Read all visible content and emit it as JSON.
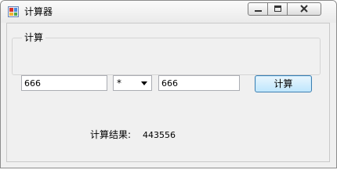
{
  "window": {
    "title": "计算器",
    "icon": "calculator-app-icon",
    "controls": {
      "minimize": "minimize-icon",
      "maximize": "restore-icon",
      "close": "close-icon"
    }
  },
  "group": {
    "label": "计算"
  },
  "inputs": {
    "operand1": "666",
    "operand2": "666"
  },
  "operator": {
    "selected": "*"
  },
  "buttons": {
    "calculate": "计算"
  },
  "result": {
    "label": "计算结果:",
    "value": "443556"
  },
  "colors": {
    "window_bg": "#f0f0f0",
    "button_border": "#3c7fb1",
    "button_fill": "#bee6fd"
  }
}
